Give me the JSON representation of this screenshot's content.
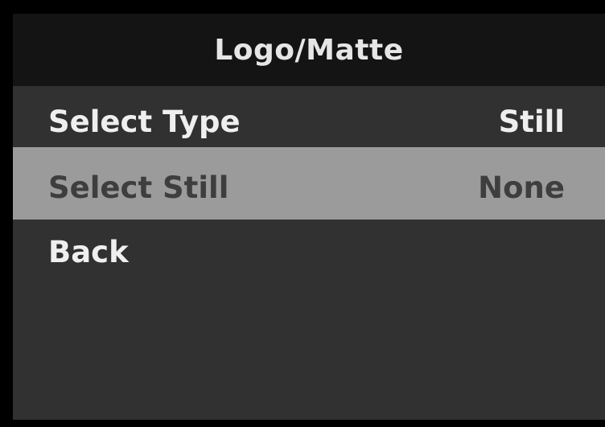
{
  "menu": {
    "title": "Logo/Matte",
    "items": [
      {
        "label": "Select Type",
        "value": "Still",
        "selected": false
      },
      {
        "label": "Select Still",
        "value": "None",
        "selected": true
      },
      {
        "label": "Back",
        "value": "",
        "selected": false
      }
    ]
  },
  "colors": {
    "title_bar": "#141414",
    "background": "#313131",
    "highlight": "#9b9b9b",
    "text": "#efefef",
    "highlight_text": "#3e3e3e"
  }
}
